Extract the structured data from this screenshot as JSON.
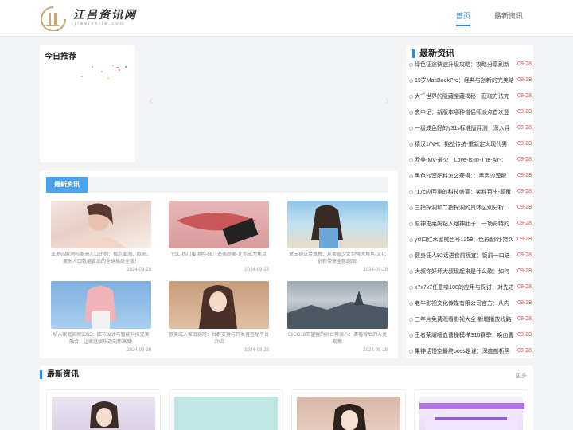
{
  "header": {
    "logo_text": "江吕资讯网",
    "logo_sub": "jiavlvsite.com",
    "nav": [
      {
        "label": "首页",
        "active": true
      },
      {
        "label": "最新资讯",
        "active": false
      }
    ]
  },
  "today": {
    "title": "今日推荐"
  },
  "latest_sidebar": {
    "title": "最新资讯",
    "items": [
      {
        "text": "绿色征途快速升级攻略：攻略分享刷新",
        "date": "09-28"
      },
      {
        "text": "19岁MacBookPro：经典与创新的完美结",
        "date": "09-28"
      },
      {
        "text": "大千世界的隐藏宝藏揭秘：获取方法完",
        "date": "09-28"
      },
      {
        "text": "玄中记：新版本哪种僧侣师派点首次登",
        "date": "09-28"
      },
      {
        "text": "一级成色好的y31s标准版评测：深入评",
        "date": "09-28"
      },
      {
        "text": "精汉1/NH：挑战传统-重新定义现代男",
        "date": "09-28"
      },
      {
        "text": "欧美-MV-最火：Love-Is-In-The-Air-：",
        "date": "09-28"
      },
      {
        "text": "黑色沙漠肥料怎么获得：：黑色沙漠肥",
        "date": "09-28"
      },
      {
        "text": "\"17c应回重的科技盛宴：笑料百出-颠覆",
        "date": "09-28"
      },
      {
        "text": "三指探洞和二指探洞的具体区别分析：",
        "date": "09-28"
      },
      {
        "text": "原神史莱姆钻入烟神肚子：一场奇特的",
        "date": "09-28"
      },
      {
        "text": "ysl口红水蜜桃色号1258：色彩翻明-持久",
        "date": "09-28"
      },
      {
        "text": "健身狂人92话进食前抚宜：饭前一口送",
        "date": "09-28"
      },
      {
        "text": "大叔你好坏大叔现起来是什么歌：如何",
        "date": "09-28"
      },
      {
        "text": "x7x7x7任意噪108的应用与探讨：对先进",
        "date": "09-28"
      },
      {
        "text": "老牛影视文化传媒有限公司官方：从内",
        "date": "09-28"
      },
      {
        "text": "三年片免费观看影视大全-新增播放线路",
        "date": "09-28"
      },
      {
        "text": "王者荣耀嗜血曹操模样S10赛季：唤血曹",
        "date": "09-28"
      },
      {
        "text": "果神话悟空最终boss是谁：深度剖析黑",
        "date": "09-28"
      }
    ]
  },
  "latest_main": {
    "tab": "最新资讯",
    "items": [
      {
        "caption": "亚洲vs欧洲vs美洲人口比例：揭示亚洲、欧洲、美洲人口数据背后的全球格局全貌！",
        "date": "2024-09-28"
      },
      {
        "caption": "YSL-热门蜜桃色-66：遥美颜美-让你成为焦点",
        "date": "2024-09-28"
      },
      {
        "caption": "黛玉初试金瓶梅：从柔弱少女到强大角色-文化创新带来全新跑图!",
        "date": "2024-09-28"
      },
      {
        "caption": "私人家庭影院3355：细节设计与智能科技完美融合，让家庭娱乐迈向新高度!",
        "date": "2024-09-28"
      },
      {
        "caption": "欧美成人家庭影院：社群支持与开发者互动平台介绍",
        "date": "2024-09-28"
      },
      {
        "caption": "51CG18回望我的对台弃派八：清楷背后的人类观察",
        "date": "2024-09-28"
      }
    ]
  },
  "bottom": {
    "title": "最新资讯",
    "more": "更多"
  },
  "colors": {
    "accent": "#2b87e6",
    "date_red": "#e0473e"
  }
}
